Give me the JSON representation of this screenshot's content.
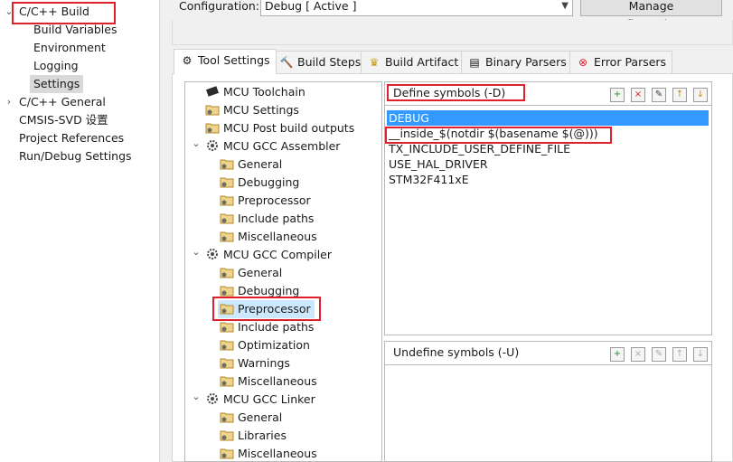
{
  "left_nav": {
    "items": [
      {
        "label": "C/C++ Build",
        "expanded": true
      },
      {
        "label": "Build Variables"
      },
      {
        "label": "Environment"
      },
      {
        "label": "Logging"
      },
      {
        "label": "Settings",
        "selected": true
      },
      {
        "label": "C/C++ General",
        "expanded": false
      },
      {
        "label": "CMSIS-SVD 设置"
      },
      {
        "label": "Project References"
      },
      {
        "label": "Run/Debug Settings"
      }
    ]
  },
  "configuration": {
    "label": "Configuration:",
    "value": "Debug  [ Active ]",
    "manage_button": "Manage Configurations..."
  },
  "tabs": [
    {
      "label": "Tool Settings",
      "icon": "tool-settings-icon",
      "active": true
    },
    {
      "label": "Build Steps",
      "icon": "build-steps-icon"
    },
    {
      "label": "Build Artifact",
      "icon": "build-artifact-icon"
    },
    {
      "label": "Binary Parsers",
      "icon": "binary-parsers-icon"
    },
    {
      "label": "Error Parsers",
      "icon": "error-parsers-icon"
    }
  ],
  "tool_tree": {
    "items": [
      {
        "label": "MCU Toolchain"
      },
      {
        "label": "MCU Settings"
      },
      {
        "label": "MCU Post build outputs"
      },
      {
        "label": "MCU GCC Assembler",
        "expanded": true
      },
      {
        "label": "General"
      },
      {
        "label": "Debugging"
      },
      {
        "label": "Preprocessor"
      },
      {
        "label": "Include paths"
      },
      {
        "label": "Miscellaneous"
      },
      {
        "label": "MCU GCC Compiler",
        "expanded": true
      },
      {
        "label": "General"
      },
      {
        "label": "Debugging"
      },
      {
        "label": "Preprocessor",
        "selected": true
      },
      {
        "label": "Include paths"
      },
      {
        "label": "Optimization"
      },
      {
        "label": "Warnings"
      },
      {
        "label": "Miscellaneous"
      },
      {
        "label": "MCU GCC Linker",
        "expanded": true
      },
      {
        "label": "General"
      },
      {
        "label": "Libraries"
      },
      {
        "label": "Miscellaneous"
      }
    ]
  },
  "define_symbols": {
    "title": "Define symbols (-D)",
    "items": [
      "DEBUG",
      "__inside_$(notdir $(basename $(@)))",
      "TX_INCLUDE_USER_DEFINE_FILE",
      "USE_HAL_DRIVER",
      "STM32F411xE"
    ],
    "selected_index": 0
  },
  "undefine_symbols": {
    "title": "Undefine symbols (-U)",
    "items": []
  },
  "toolbar_icons": [
    "add-icon",
    "delete-icon",
    "edit-icon",
    "move-up-icon",
    "move-down-icon"
  ],
  "colors": {
    "selection": "#3399ff",
    "tree_selection": "#cce8ff",
    "highlight_box": "#e0202c"
  }
}
